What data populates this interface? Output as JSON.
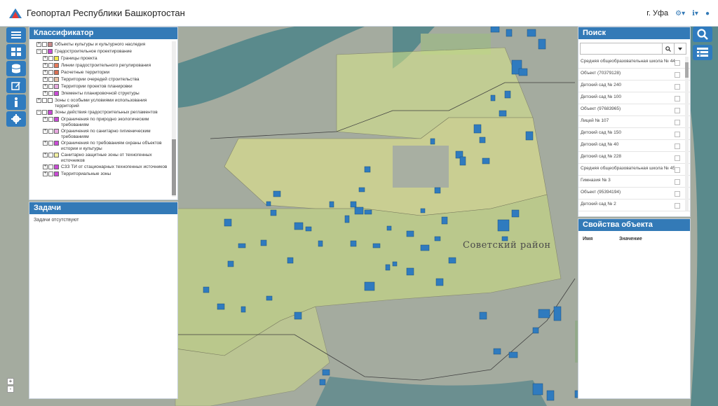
{
  "header": {
    "title": "Геопортал Республики Башкортостан",
    "city": "г. Уфа",
    "settings_icon": "gears-icon",
    "info_icon": "info-icon",
    "user_icon": "user-icon"
  },
  "left_toolbar": {
    "buttons": [
      {
        "icon": "menu-icon"
      },
      {
        "icon": "grid-icon"
      },
      {
        "icon": "database-icon"
      },
      {
        "icon": "edit-icon"
      },
      {
        "icon": "info-icon"
      },
      {
        "icon": "settings-icon"
      }
    ]
  },
  "classifier": {
    "title": "Классификатор",
    "items": [
      {
        "label": "Объекты культуры и культурного наследия",
        "color": "#c98a8a",
        "indent": 0,
        "expand": "+"
      },
      {
        "label": "Градостроительное проектирование",
        "color": "#c94ad6",
        "indent": 0,
        "expand": "−"
      },
      {
        "label": "Границы проекта",
        "color": "#f2e94b",
        "indent": 1,
        "expand": "+"
      },
      {
        "label": "Линии градостроительного регулирования",
        "color": "#e87a5a",
        "indent": 1,
        "expand": "+"
      },
      {
        "label": "Расчетные территории",
        "color": "#d96f54",
        "indent": 1,
        "expand": "+"
      },
      {
        "label": "Территории очередей строительства",
        "color": "#e8c1a8",
        "indent": 1,
        "expand": "+"
      },
      {
        "label": "Территории проектов планировки",
        "color": "#e7a8e0",
        "indent": 1,
        "expand": "+"
      },
      {
        "label": "Элементы планировочной структуры",
        "color": "#c94ad6",
        "indent": 1,
        "expand": "+"
      },
      {
        "label": "Зоны с особыми условиями использования территорий",
        "color": "#ffffff",
        "indent": 0,
        "expand": "+"
      },
      {
        "label": "Зоны действия градостроительных регламентов",
        "color": "#c94ad6",
        "indent": 0,
        "expand": "−"
      },
      {
        "label": "Ограничения по природно экологическим требованиям",
        "color": "#c94ad6",
        "indent": 1,
        "expand": "+"
      },
      {
        "label": "Ограничения по санитарно гигиеническим требованиям",
        "color": "#e7a8e0",
        "indent": 1,
        "expand": "+"
      },
      {
        "label": "Ограничения по требованиям охраны объектов истории и культуры",
        "color": "#c94ad6",
        "indent": 1,
        "expand": "+"
      },
      {
        "label": "Санитарно защитные зоны от техногенных источников",
        "color": "#f2f0a0",
        "indent": 1,
        "expand": "+"
      },
      {
        "label": "СЗЗ ТИ от стационарных техногенных источников",
        "color": "#c94ad6",
        "indent": 1,
        "expand": "+"
      },
      {
        "label": "Территориальные зоны",
        "color": "#c94ad6",
        "indent": 1,
        "expand": "+"
      }
    ]
  },
  "tasks": {
    "title": "Задачи",
    "empty_text": "Задачи отсутствуют"
  },
  "map": {
    "district_label": "Советский район"
  },
  "zoom": {
    "plus": "+",
    "minus": "-"
  },
  "search": {
    "title": "Поиск",
    "input_value": "",
    "search_icon": "search-icon",
    "dropdown_icon": "caret-down-icon",
    "results": [
      "Средняя общеобразовательная школа № 44",
      "Объект (70379128)",
      "Детский сад № 240",
      "Детский сад № 100",
      "Объект (97683965)",
      "Лицей № 107",
      "Детский сад № 150",
      "Детский сад № 40",
      "Детский сад № 228",
      "Средняя общеобразовательная школа № 45",
      "Гимназия № 3",
      "Объект (95394194)",
      "Детский сад № 2"
    ]
  },
  "properties": {
    "title": "Свойства объекта",
    "col_name": "Имя",
    "col_value": "Значение"
  },
  "right_toolbar": {
    "buttons": [
      {
        "icon": "search-icon"
      },
      {
        "icon": "layers-icon"
      }
    ]
  },
  "colors": {
    "accent": "#337ab7",
    "zone_fill": "#d9e88a",
    "building_fill": "#2f7bbf"
  }
}
